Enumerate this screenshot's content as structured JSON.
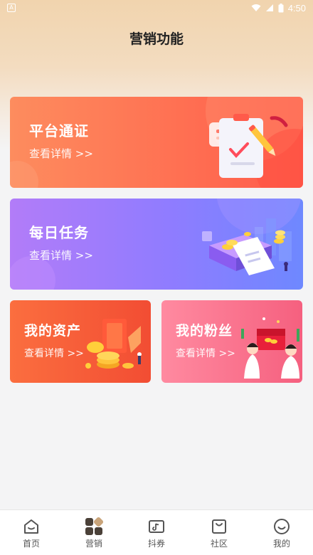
{
  "status_bar": {
    "time": "4:50",
    "app_badge": "A"
  },
  "page_title": "营销功能",
  "cards": {
    "platform": {
      "title": "平台通证",
      "link": "查看详情 >>"
    },
    "daily": {
      "title": "每日任务",
      "link": "查看详情 >>"
    },
    "assets": {
      "title": "我的资产",
      "link": "查看详情 >>"
    },
    "fans": {
      "title": "我的粉丝",
      "link": "查看详情 >>"
    }
  },
  "nav": {
    "items": [
      {
        "label": "首页",
        "icon": "home-icon"
      },
      {
        "label": "营销",
        "icon": "marketing-grid-icon",
        "active": true
      },
      {
        "label": "抖券",
        "icon": "coupon-icon"
      },
      {
        "label": "社区",
        "icon": "community-bag-icon"
      },
      {
        "label": "我的",
        "icon": "smile-profile-icon"
      }
    ]
  },
  "colors": {
    "platform_card": "#ff6f52",
    "daily_card": "#8f7cff",
    "assets_card": "#f24d33",
    "fans_card": "#f5607f",
    "nav_active": "#6b5a48"
  }
}
